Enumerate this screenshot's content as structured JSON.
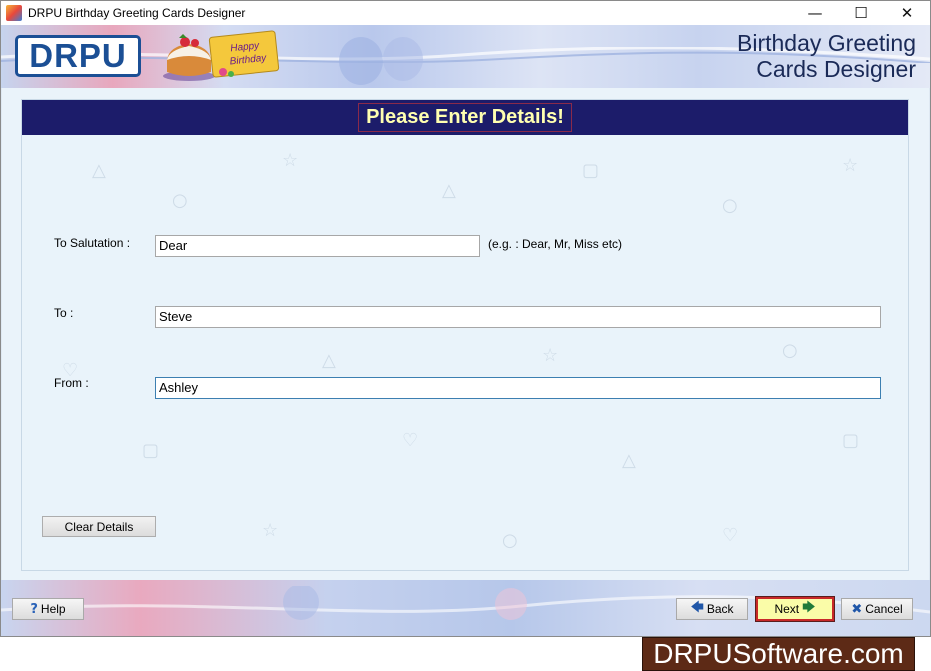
{
  "window": {
    "title": "DRPU Birthday Greeting Cards Designer",
    "controls": {
      "minimize": "—",
      "maximize": "☐",
      "close": "✕"
    }
  },
  "banner": {
    "logo": "DRPU",
    "card_text_line1": "Happy",
    "card_text_line2": "Birthday",
    "app_name_line1": "Birthday Greeting",
    "app_name_line2": "Cards Designer"
  },
  "form": {
    "header": "Please Enter Details!",
    "salutation": {
      "label": "To Salutation :",
      "value": "Dear",
      "hint": "(e.g. : Dear, Mr, Miss etc)"
    },
    "to": {
      "label": "To :",
      "value": "Steve"
    },
    "from": {
      "label": "From :",
      "value": "Ashley"
    },
    "clear_button": "Clear Details"
  },
  "footer": {
    "help": "Help",
    "back": "Back",
    "next": "Next",
    "cancel": "Cancel",
    "icons": {
      "help": "?",
      "back": "🡄",
      "next": "🡆",
      "cancel": "✖"
    }
  },
  "brand_caption": "DRPUSoftware.com",
  "colors": {
    "header_bar": "#1c1c6a",
    "header_text": "#ffffb0",
    "logo_blue": "#1b4f95",
    "next_highlight": "#fafca8",
    "brand_bg": "#5d2a16"
  }
}
